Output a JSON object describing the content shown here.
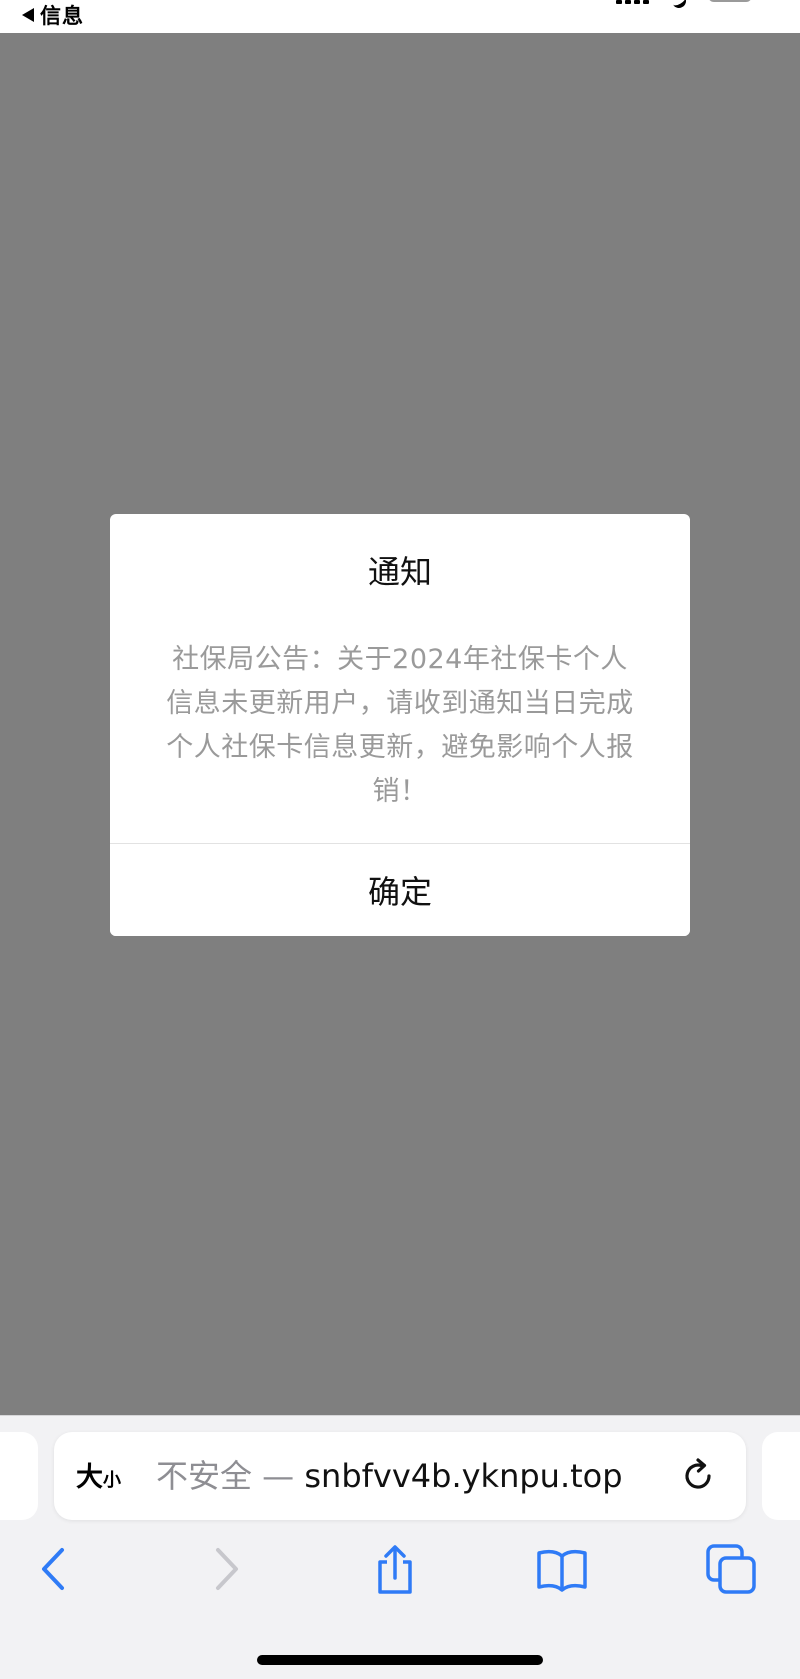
{
  "status_bar": {
    "back_app_label": "信息"
  },
  "dialog": {
    "title": "通知",
    "message": "社保局公告：关于2024年社保卡个人信息未更新用户，请收到通知当日完成个人社保卡信息更新，避免影响个人报销！",
    "confirm_label": "确定"
  },
  "address_bar": {
    "reader_size_big": "大",
    "reader_size_small": "小",
    "security_text": "不安全 — ",
    "domain": "snbfvv4b.yknpu.top"
  },
  "toolbar": {
    "back_enabled": true,
    "forward_enabled": false
  },
  "colors": {
    "accent": "#2f7bf6",
    "disabled": "#c7c7cc",
    "overlay": "#7f7f7f"
  },
  "icons": {
    "back": "chevron-left-icon",
    "forward": "chevron-right-icon",
    "share": "share-icon",
    "bookmarks": "book-icon",
    "tabs": "tabs-icon",
    "reload": "reload-icon"
  }
}
